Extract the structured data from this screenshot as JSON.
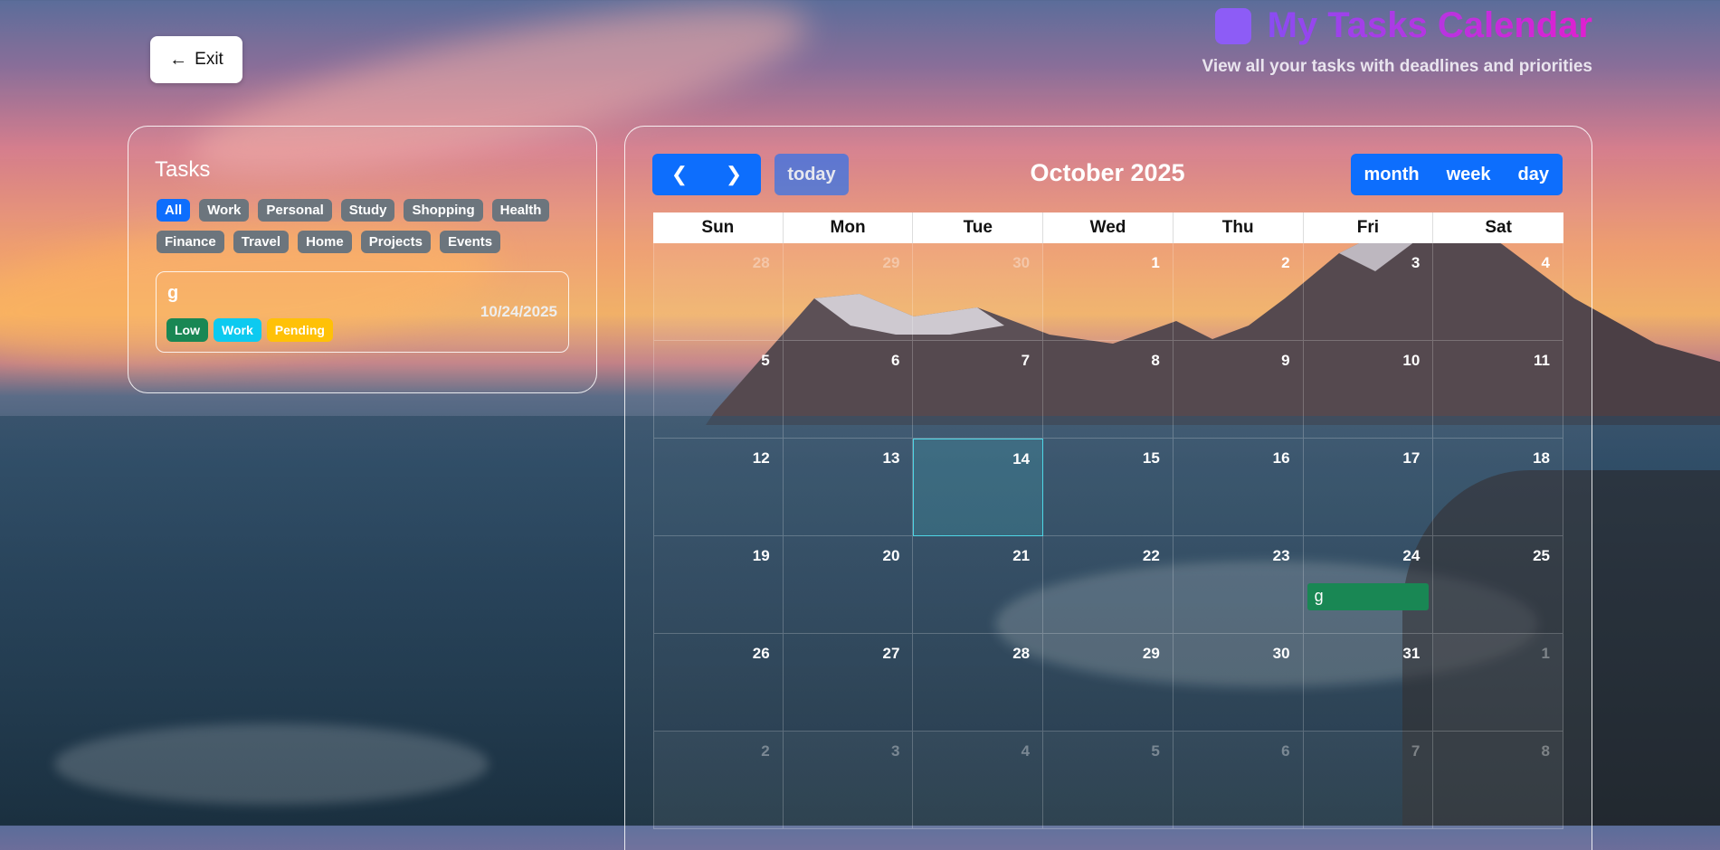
{
  "header": {
    "title": "My Tasks Calendar",
    "subtitle": "View all your tasks with deadlines and priorities",
    "logo_color": "#8d5cf6"
  },
  "exit": {
    "label": "Exit",
    "icon": "arrow-left-icon"
  },
  "tasks": {
    "heading": "Tasks",
    "categories": [
      "All",
      "Work",
      "Personal",
      "Study",
      "Shopping",
      "Health",
      "Finance",
      "Travel",
      "Home",
      "Projects",
      "Events"
    ],
    "active_category": "All",
    "items": [
      {
        "name": "g",
        "date": "10/24/2025",
        "priority": "Low",
        "category": "Work",
        "status": "Pending"
      }
    ]
  },
  "calendar": {
    "title": "October 2025",
    "prev_icon": "chevron-left-icon",
    "next_icon": "chevron-right-icon",
    "today_label": "today",
    "views": [
      "month",
      "week",
      "day"
    ],
    "days_of_week": [
      "Sun",
      "Mon",
      "Tue",
      "Wed",
      "Thu",
      "Fri",
      "Sat"
    ],
    "weeks": [
      [
        {
          "n": "28",
          "other": true
        },
        {
          "n": "29",
          "other": true
        },
        {
          "n": "30",
          "other": true
        },
        {
          "n": "1"
        },
        {
          "n": "2"
        },
        {
          "n": "3"
        },
        {
          "n": "4"
        }
      ],
      [
        {
          "n": "5"
        },
        {
          "n": "6"
        },
        {
          "n": "7"
        },
        {
          "n": "8"
        },
        {
          "n": "9"
        },
        {
          "n": "10"
        },
        {
          "n": "11"
        }
      ],
      [
        {
          "n": "12"
        },
        {
          "n": "13"
        },
        {
          "n": "14",
          "today": true
        },
        {
          "n": "15"
        },
        {
          "n": "16"
        },
        {
          "n": "17"
        },
        {
          "n": "18"
        }
      ],
      [
        {
          "n": "19"
        },
        {
          "n": "20"
        },
        {
          "n": "21"
        },
        {
          "n": "22"
        },
        {
          "n": "23"
        },
        {
          "n": "24",
          "event": "g"
        },
        {
          "n": "25"
        }
      ],
      [
        {
          "n": "26"
        },
        {
          "n": "27"
        },
        {
          "n": "28"
        },
        {
          "n": "29"
        },
        {
          "n": "30"
        },
        {
          "n": "31"
        },
        {
          "n": "1",
          "other": true
        }
      ],
      [
        {
          "n": "2",
          "other": true
        },
        {
          "n": "3",
          "other": true
        },
        {
          "n": "4",
          "other": true
        },
        {
          "n": "5",
          "other": true
        },
        {
          "n": "6",
          "other": true
        },
        {
          "n": "7",
          "other": true
        },
        {
          "n": "8",
          "other": true
        }
      ]
    ],
    "event_color": "#198754",
    "accent": "#0d6efd"
  }
}
